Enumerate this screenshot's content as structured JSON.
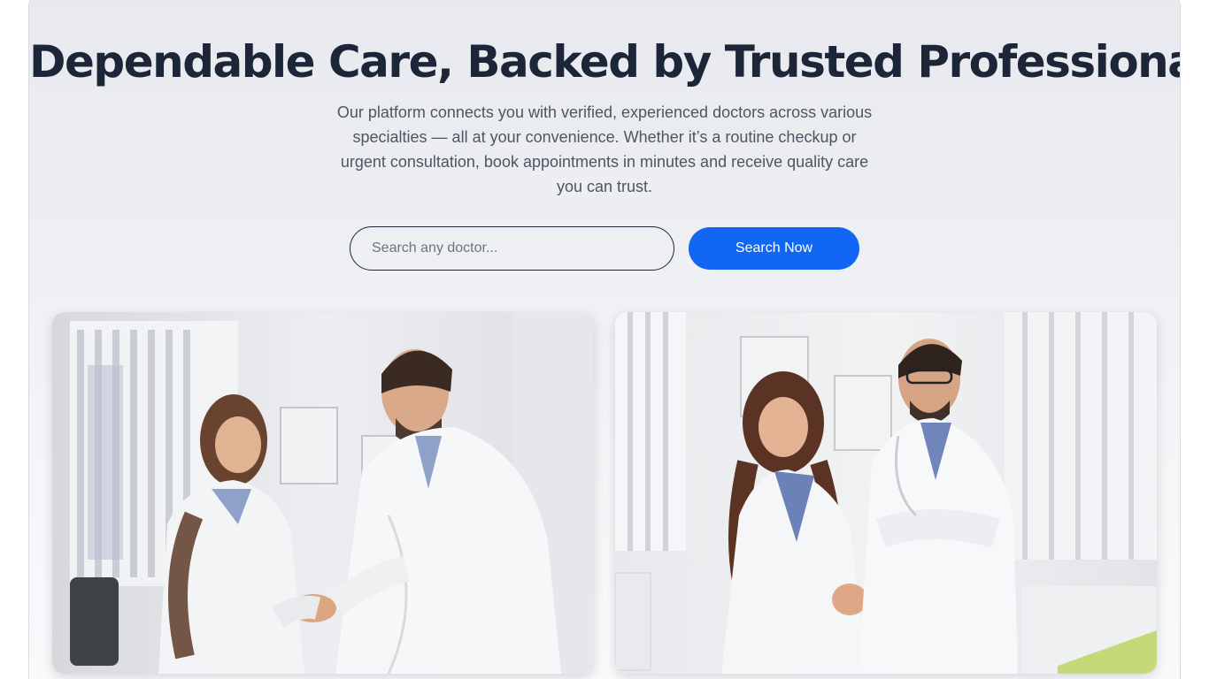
{
  "hero": {
    "title": "Dependable Care, Backed by Trusted Professionals.",
    "subtitle": "Our platform connects you with verified, experienced doctors across various specialties — all at your convenience. Whether it’s a routine checkup or urgent consultation, book appointments in minutes and receive quality care you can trust."
  },
  "search": {
    "placeholder": "Search any doctor...",
    "value": "",
    "button_label": "Search Now"
  },
  "images": {
    "left": "doctors-handshake-photo",
    "right": "doctors-standing-smiling-photo"
  },
  "colors": {
    "heading": "#1d2638",
    "body_text": "#4e5563",
    "accent": "#1166f4"
  }
}
